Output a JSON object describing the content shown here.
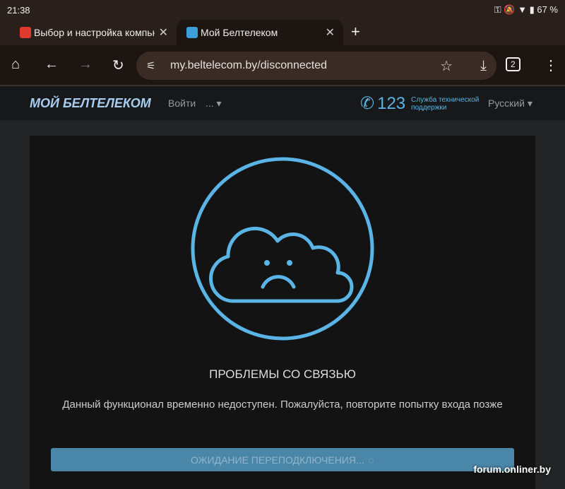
{
  "status": {
    "time": "21:38",
    "battery": "67 %"
  },
  "tabs": [
    {
      "title": "Выбор и настройка компьютера"
    },
    {
      "title": "Мой Белтелеком"
    }
  ],
  "toolbar": {
    "url": "my.beltelecom.by/disconnected",
    "tab_count": "2"
  },
  "site": {
    "logo": "МОЙ БЕЛТЕЛЕКОМ",
    "login": "Войти",
    "more": "...",
    "phone": "123",
    "support": "Служба технической поддержки",
    "lang": "Русский"
  },
  "main": {
    "title": "ПРОБЛЕМЫ СО СВЯЗЬЮ",
    "message": "Данный функционал временно недоступен. Пожалуйста, повторите попытку входа позже",
    "button": "ОЖИДАНИЕ ПЕРЕПОДКЛЮЧЕНИЯ..."
  },
  "watermark": "forum.onliner.by",
  "colors": {
    "accent": "#5ab4e5",
    "button": "#4a86a8"
  }
}
